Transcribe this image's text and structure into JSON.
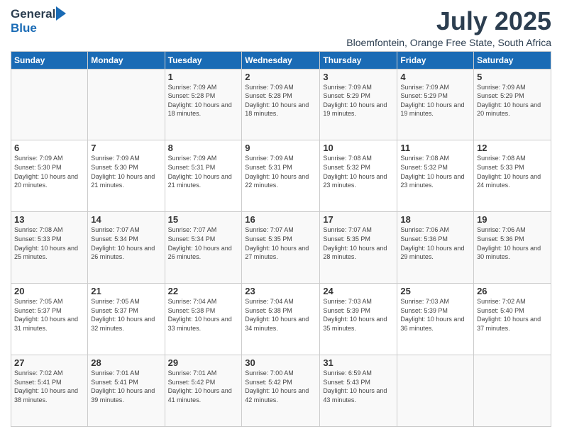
{
  "logo": {
    "general": "General",
    "blue": "Blue"
  },
  "title": "July 2025",
  "subtitle": "Bloemfontein, Orange Free State, South Africa",
  "days_of_week": [
    "Sunday",
    "Monday",
    "Tuesday",
    "Wednesday",
    "Thursday",
    "Friday",
    "Saturday"
  ],
  "weeks": [
    [
      {
        "day": "",
        "content": ""
      },
      {
        "day": "",
        "content": ""
      },
      {
        "day": "1",
        "content": "Sunrise: 7:09 AM\nSunset: 5:28 PM\nDaylight: 10 hours and 18 minutes."
      },
      {
        "day": "2",
        "content": "Sunrise: 7:09 AM\nSunset: 5:28 PM\nDaylight: 10 hours and 18 minutes."
      },
      {
        "day": "3",
        "content": "Sunrise: 7:09 AM\nSunset: 5:29 PM\nDaylight: 10 hours and 19 minutes."
      },
      {
        "day": "4",
        "content": "Sunrise: 7:09 AM\nSunset: 5:29 PM\nDaylight: 10 hours and 19 minutes."
      },
      {
        "day": "5",
        "content": "Sunrise: 7:09 AM\nSunset: 5:29 PM\nDaylight: 10 hours and 20 minutes."
      }
    ],
    [
      {
        "day": "6",
        "content": "Sunrise: 7:09 AM\nSunset: 5:30 PM\nDaylight: 10 hours and 20 minutes."
      },
      {
        "day": "7",
        "content": "Sunrise: 7:09 AM\nSunset: 5:30 PM\nDaylight: 10 hours and 21 minutes."
      },
      {
        "day": "8",
        "content": "Sunrise: 7:09 AM\nSunset: 5:31 PM\nDaylight: 10 hours and 21 minutes."
      },
      {
        "day": "9",
        "content": "Sunrise: 7:09 AM\nSunset: 5:31 PM\nDaylight: 10 hours and 22 minutes."
      },
      {
        "day": "10",
        "content": "Sunrise: 7:08 AM\nSunset: 5:32 PM\nDaylight: 10 hours and 23 minutes."
      },
      {
        "day": "11",
        "content": "Sunrise: 7:08 AM\nSunset: 5:32 PM\nDaylight: 10 hours and 23 minutes."
      },
      {
        "day": "12",
        "content": "Sunrise: 7:08 AM\nSunset: 5:33 PM\nDaylight: 10 hours and 24 minutes."
      }
    ],
    [
      {
        "day": "13",
        "content": "Sunrise: 7:08 AM\nSunset: 5:33 PM\nDaylight: 10 hours and 25 minutes."
      },
      {
        "day": "14",
        "content": "Sunrise: 7:07 AM\nSunset: 5:34 PM\nDaylight: 10 hours and 26 minutes."
      },
      {
        "day": "15",
        "content": "Sunrise: 7:07 AM\nSunset: 5:34 PM\nDaylight: 10 hours and 26 minutes."
      },
      {
        "day": "16",
        "content": "Sunrise: 7:07 AM\nSunset: 5:35 PM\nDaylight: 10 hours and 27 minutes."
      },
      {
        "day": "17",
        "content": "Sunrise: 7:07 AM\nSunset: 5:35 PM\nDaylight: 10 hours and 28 minutes."
      },
      {
        "day": "18",
        "content": "Sunrise: 7:06 AM\nSunset: 5:36 PM\nDaylight: 10 hours and 29 minutes."
      },
      {
        "day": "19",
        "content": "Sunrise: 7:06 AM\nSunset: 5:36 PM\nDaylight: 10 hours and 30 minutes."
      }
    ],
    [
      {
        "day": "20",
        "content": "Sunrise: 7:05 AM\nSunset: 5:37 PM\nDaylight: 10 hours and 31 minutes."
      },
      {
        "day": "21",
        "content": "Sunrise: 7:05 AM\nSunset: 5:37 PM\nDaylight: 10 hours and 32 minutes."
      },
      {
        "day": "22",
        "content": "Sunrise: 7:04 AM\nSunset: 5:38 PM\nDaylight: 10 hours and 33 minutes."
      },
      {
        "day": "23",
        "content": "Sunrise: 7:04 AM\nSunset: 5:38 PM\nDaylight: 10 hours and 34 minutes."
      },
      {
        "day": "24",
        "content": "Sunrise: 7:03 AM\nSunset: 5:39 PM\nDaylight: 10 hours and 35 minutes."
      },
      {
        "day": "25",
        "content": "Sunrise: 7:03 AM\nSunset: 5:39 PM\nDaylight: 10 hours and 36 minutes."
      },
      {
        "day": "26",
        "content": "Sunrise: 7:02 AM\nSunset: 5:40 PM\nDaylight: 10 hours and 37 minutes."
      }
    ],
    [
      {
        "day": "27",
        "content": "Sunrise: 7:02 AM\nSunset: 5:41 PM\nDaylight: 10 hours and 38 minutes."
      },
      {
        "day": "28",
        "content": "Sunrise: 7:01 AM\nSunset: 5:41 PM\nDaylight: 10 hours and 39 minutes."
      },
      {
        "day": "29",
        "content": "Sunrise: 7:01 AM\nSunset: 5:42 PM\nDaylight: 10 hours and 41 minutes."
      },
      {
        "day": "30",
        "content": "Sunrise: 7:00 AM\nSunset: 5:42 PM\nDaylight: 10 hours and 42 minutes."
      },
      {
        "day": "31",
        "content": "Sunrise: 6:59 AM\nSunset: 5:43 PM\nDaylight: 10 hours and 43 minutes."
      },
      {
        "day": "",
        "content": ""
      },
      {
        "day": "",
        "content": ""
      }
    ]
  ]
}
